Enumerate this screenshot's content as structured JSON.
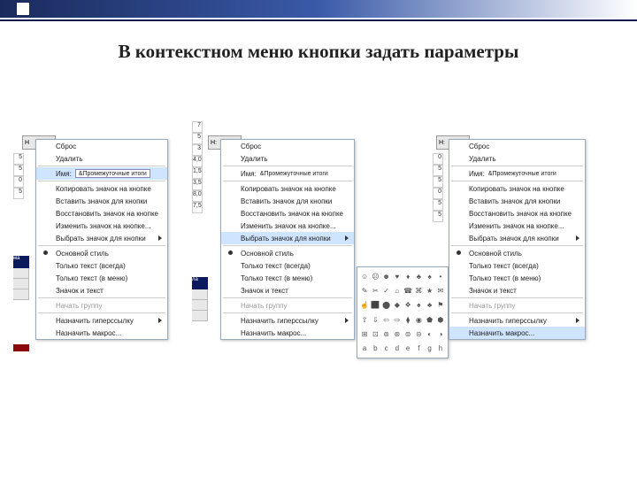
{
  "header": {
    "title": "В контекстном меню кнопки задать параметры"
  },
  "toolbar": {
    "labels": [
      "Н",
      "Н:",
      "Н:"
    ]
  },
  "sheet": {
    "rows1": [
      "5",
      "5",
      "0",
      "5"
    ],
    "rows2": [
      "7",
      "5",
      "3",
      "4,0",
      "1,5",
      "3,5",
      "8,0",
      "7,5"
    ],
    "rows3": [
      "0",
      "5",
      "5",
      "0",
      "5",
      "5"
    ]
  },
  "sideband": {
    "label": "ма",
    "label2": "ла",
    "label3": "ла"
  },
  "menu_items": {
    "reset": "Сброс",
    "delete": "Удалить",
    "name": "Имя:",
    "name_placeholder": "&Промежуточные итоги",
    "copy_icon": "Копировать значок на кнопке",
    "paste_icon": "Вставить значок для кнопки",
    "restore_icon": "Восстановить значок на кнопке",
    "change_icon": "Изменить значок на кнопке...",
    "select_icon": "Выбрать значок для кнопки",
    "default_style": "Основной стиль",
    "text_always": "Только текст (всегда)",
    "text_menu": "Только текст (в меню)",
    "icon_text": "Значок и текст",
    "start_group": "Начать группу",
    "hyperlink": "Назначить гиперссылку",
    "macro": "Назначить макрос..."
  },
  "panels": {
    "highlight1": "name",
    "highlight2": "select_icon",
    "highlight3": "macro"
  },
  "iconpanel": {
    "icons": [
      "☺",
      "☹",
      "☻",
      "♥",
      "♦",
      "♣",
      "♠",
      "•",
      "✎",
      "✂",
      "✓",
      "⌂",
      "☎",
      "⌘",
      "★",
      "✉",
      "☝",
      "⬛",
      "⬤",
      "◆",
      "❖",
      "♠",
      "♣",
      "⚑",
      "⇧",
      "⇩",
      "⇦",
      "⇨",
      "⧫",
      "◉",
      "⬟",
      "⬢",
      "⊞",
      "⊡",
      "⊚",
      "⊛",
      "⊜",
      "⊝",
      "◐",
      "◑",
      "a",
      "b",
      "c",
      "d",
      "e",
      "f",
      "g",
      "h"
    ]
  }
}
